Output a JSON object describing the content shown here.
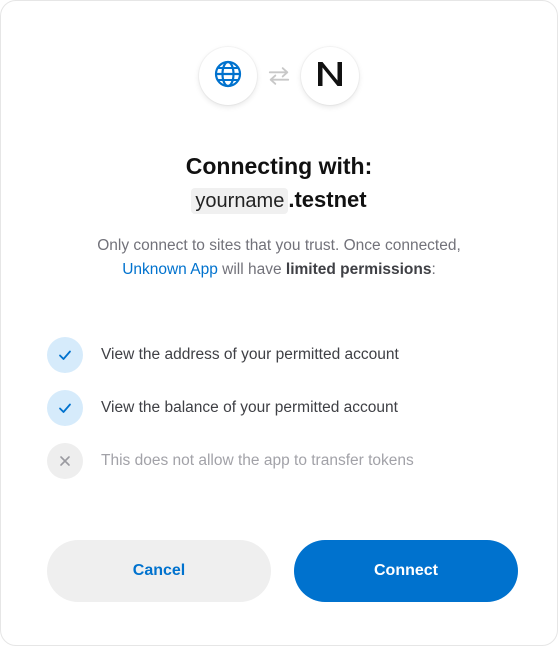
{
  "header": {
    "app_icon": "globe-icon",
    "swap_icon": "swap-arrows-icon",
    "wallet_icon": "near-logo-icon"
  },
  "title": "Connecting with:",
  "account": {
    "name": "yourname",
    "suffix": ".testnet"
  },
  "description": {
    "line1": "Only connect to sites that you trust. Once connected,",
    "app_name": "Unknown App",
    "middle": " will have ",
    "strong": "limited permissions",
    "end": ":"
  },
  "permissions": [
    {
      "text": "View the address of your permitted account",
      "allowed": true,
      "icon": "check-icon"
    },
    {
      "text": "View the balance of your permitted account",
      "allowed": true,
      "icon": "check-icon"
    },
    {
      "text": "This does not allow the app to transfer tokens",
      "allowed": false,
      "icon": "x-icon"
    }
  ],
  "buttons": {
    "cancel": "Cancel",
    "connect": "Connect"
  },
  "colors": {
    "accent": "#0072ce",
    "check_bg": "#d6ebfb",
    "muted_bg": "#eeeeee",
    "muted_text": "#a2a2a8"
  }
}
